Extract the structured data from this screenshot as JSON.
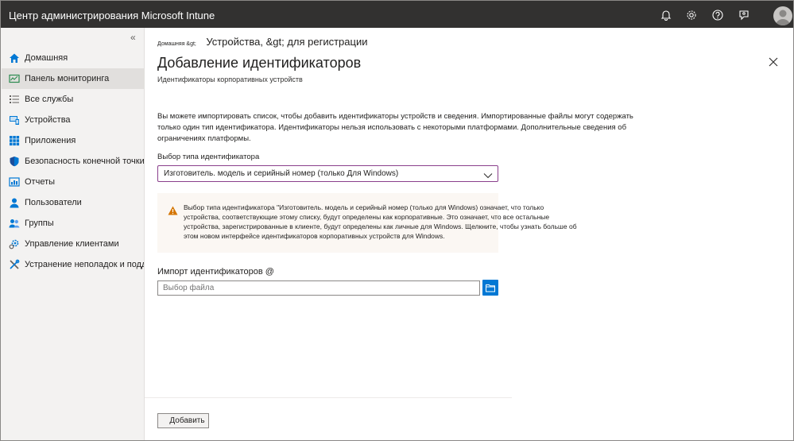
{
  "header": {
    "app_title": "Центр администрирования Microsoft Intune",
    "icons": [
      "bell-icon",
      "gear-icon",
      "help-icon",
      "feedback-icon",
      "avatar"
    ]
  },
  "sidebar": {
    "collapse_label": "«",
    "items": [
      {
        "label": "Домашняя",
        "icon": "home-icon"
      },
      {
        "label": "Панель мониторинга",
        "icon": "dashboard-icon",
        "active": true
      },
      {
        "label": "Все службы",
        "icon": "list-icon"
      },
      {
        "label": "Устройства",
        "icon": "devices-icon"
      },
      {
        "label": "Приложения",
        "icon": "apps-icon"
      },
      {
        "label": "Безопасность конечной точки",
        "icon": "shield-icon"
      },
      {
        "label": "Отчеты",
        "icon": "reports-icon"
      },
      {
        "label": "Пользователи",
        "icon": "user-icon"
      },
      {
        "label": "Группы",
        "icon": "groups-icon"
      },
      {
        "label": "Управление клиентами",
        "icon": "tenant-admin-icon"
      },
      {
        "label": "Устранение неполадок и поддержка",
        "icon": "troubleshoot-icon"
      }
    ]
  },
  "breadcrumb": {
    "small": "Домашняя &gt;",
    "separator": "",
    "current": "Устройства, &gt; для регистрации"
  },
  "page": {
    "title": "Добавление идентификаторов",
    "subtitle": "Идентификаторы корпоративных устройств",
    "description": "Вы можете импортировать список, чтобы добавить идентификаторы устройств и сведения. Импортированные файлы могут содержать только один тип идентификатора. Идентификаторы нельзя использовать с некоторыми платформами. Дополнительные сведения об ограничениях платформы."
  },
  "form": {
    "type_label": "Выбор типа идентификатора",
    "type_selected": "Изготовитель. модель и серийный номер (только Для Windows)",
    "warning_text": "Выбор типа идентификатора \"Изготовитель. модель и серийный номер (только для Windows) означает, что только устройства, соответствующие этому списку, будут определены как корпоративные. Это означает, что все остальные устройства, зарегистрированные в клиенте, будут определены как личные для Windows. Щелкните, чтобы узнать больше об этом новом интерфейсе идентификаторов корпоративных устройств для Windows.",
    "import_label": "Импорт идентификаторов @",
    "file_placeholder": "Выбор файла",
    "add_button": "Добавить"
  },
  "colors": {
    "topbar": "#323130",
    "sidebar": "#f3f2f1",
    "accent": "#0078d4",
    "warning": "#d47500",
    "dropdown_border": "#8a3f8c"
  }
}
